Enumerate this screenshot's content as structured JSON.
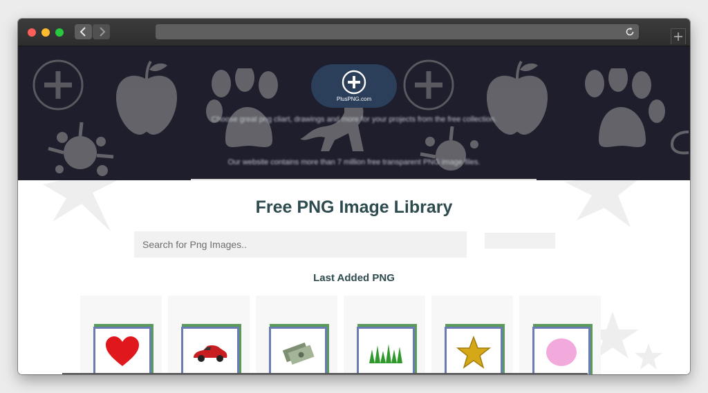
{
  "browser": {
    "back_icon": "chevron-left-icon",
    "forward_icon": "chevron-right-icon",
    "reload_icon": "reload-icon",
    "new_tab_icon": "plus-icon",
    "url": ""
  },
  "hero": {
    "logo_text": "PlusPNG.com",
    "tagline": "Choose great png cliart, drawings and more for your projects from the free collection.",
    "subline": "Our website contains more than 7 million free transparent PNG image files.",
    "background_color": "#1e1e2c",
    "logo_color": "#2c3f5a"
  },
  "main": {
    "title": "Free PNG Image Library",
    "search": {
      "placeholder": "Search for Png Images..",
      "value": ""
    },
    "search_button_label": "",
    "last_added_heading": "Last Added PNG",
    "accent_color": "#2d4a4e"
  },
  "thumbnails": [
    {
      "name": "heart"
    },
    {
      "name": "red-car"
    },
    {
      "name": "money"
    },
    {
      "name": "grass"
    },
    {
      "name": "gold-star"
    },
    {
      "name": "pink-circle"
    }
  ]
}
